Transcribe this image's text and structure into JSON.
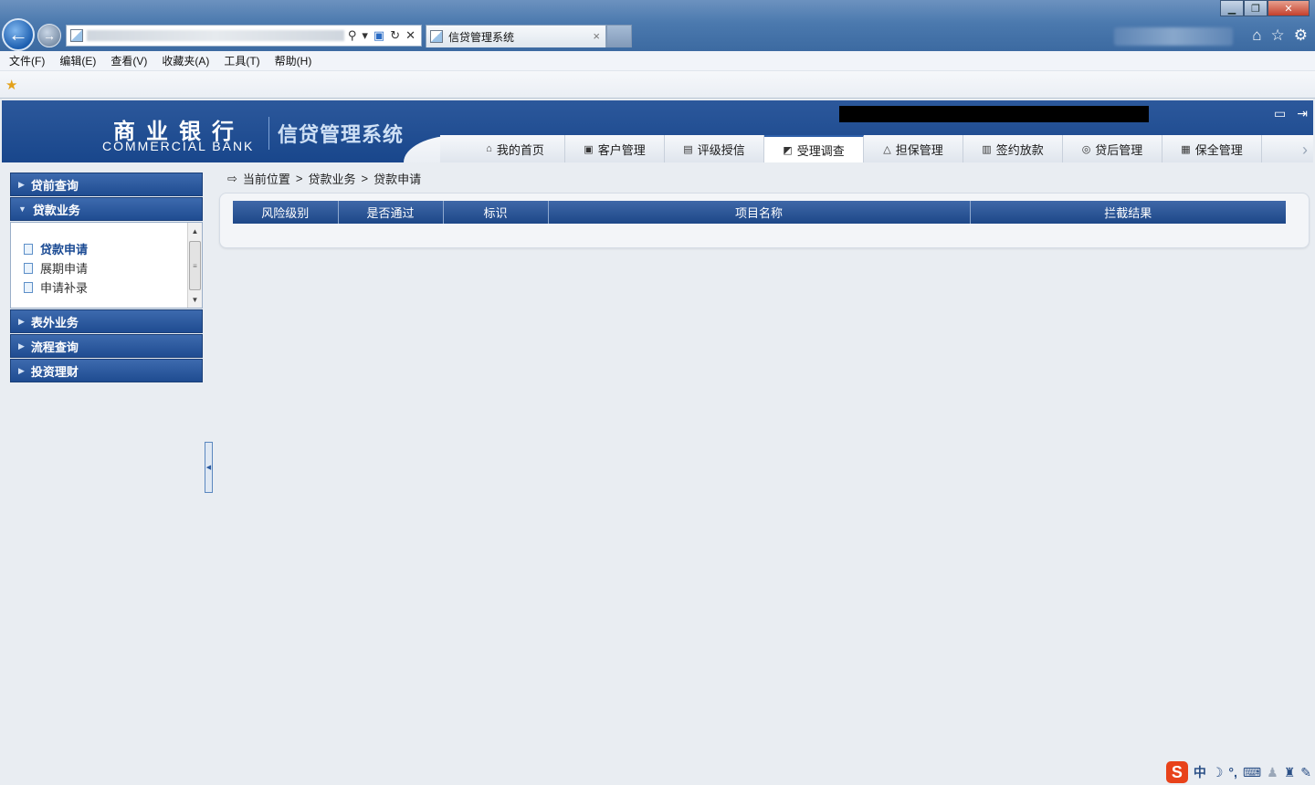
{
  "browser": {
    "tab_title": "信贷管理系统",
    "tab_close": "×",
    "menu": [
      "文件(F)",
      "编辑(E)",
      "查看(V)",
      "收藏夹(A)",
      "工具(T)",
      "帮助(H)"
    ],
    "window_controls": {
      "minimize": "▁",
      "maximize": "❐",
      "close": "✕"
    },
    "right_tools": {
      "home": "⌂",
      "favorites": "☆",
      "settings": "⚙"
    },
    "address_tools": {
      "search": "⚲",
      "dropdown": "▾",
      "compat": "▣",
      "refresh": "↻",
      "stop": "✕"
    }
  },
  "header": {
    "bank_name_cn": "商业银行",
    "bank_name_en": "COMMERCIAL BANK",
    "system_name": "信贷管理系统",
    "icons": {
      "monitor": "▭",
      "logout": "⇥"
    }
  },
  "nav": {
    "tabs": [
      {
        "label": "我的首页",
        "icon": "⌂",
        "icon_name": "home-icon",
        "active": false
      },
      {
        "label": "客户管理",
        "icon": "▣",
        "icon_name": "customer-icon",
        "active": false
      },
      {
        "label": "评级授信",
        "icon": "▤",
        "icon_name": "rating-icon",
        "active": false
      },
      {
        "label": "受理调查",
        "icon": "◩",
        "icon_name": "survey-icon",
        "active": true
      },
      {
        "label": "担保管理",
        "icon": "△",
        "icon_name": "guarantee-icon",
        "active": false
      },
      {
        "label": "签约放款",
        "icon": "▥",
        "icon_name": "contract-icon",
        "active": false
      },
      {
        "label": "贷后管理",
        "icon": "◎",
        "icon_name": "post-loan-icon",
        "active": false
      },
      {
        "label": "保全管理",
        "icon": "▦",
        "icon_name": "preservation-icon",
        "active": false
      }
    ],
    "next_arrow": "›"
  },
  "sidebar": {
    "sections": [
      {
        "label": "贷前查询",
        "expanded": false
      },
      {
        "label": "贷款业务",
        "expanded": true
      },
      {
        "label": "表外业务",
        "expanded": false
      },
      {
        "label": "流程查询",
        "expanded": false
      },
      {
        "label": "投资理财",
        "expanded": false
      }
    ],
    "loan_items": [
      {
        "label": "贷款申请",
        "current": true
      },
      {
        "label": "展期申请",
        "current": false
      },
      {
        "label": "申请补录",
        "current": false
      }
    ]
  },
  "breadcrumb": {
    "prefix": "当前位置",
    "separator": ">",
    "items": [
      "贷款业务",
      "贷款申请"
    ]
  },
  "result_table": {
    "columns": [
      "风险级别",
      "是否通过",
      "标识",
      "项目名称",
      "拦截结果"
    ],
    "rows": []
  },
  "ime": {
    "logo": "S",
    "mode": "中",
    "icons": [
      "☽",
      "°,",
      "⌨",
      "♟",
      "♜",
      "✎"
    ]
  },
  "colors": {
    "header_blue": "#1a4a93",
    "accordion_blue": "#1f4c91",
    "table_header_blue": "#1d4788",
    "background": "#e9edf2"
  }
}
